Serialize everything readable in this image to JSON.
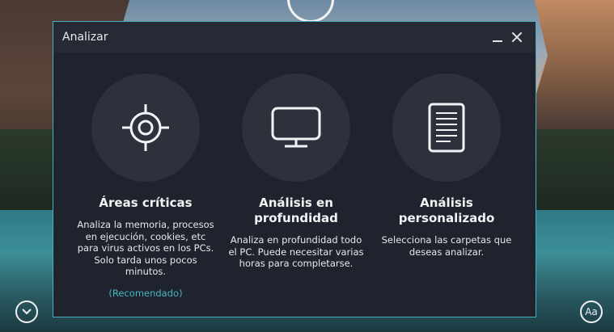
{
  "dialog": {
    "title": "Analizar",
    "minimize_icon": "minimize-icon",
    "close_icon": "close-icon"
  },
  "options": [
    {
      "icon": "crosshair-icon",
      "title": "Áreas críticas",
      "description": "Analiza la memoria, procesos en ejecución, cookies, etc para virus activos en los PCs. Solo tarda unos pocos minutos.",
      "recommended": "(Recomendado)"
    },
    {
      "icon": "monitor-icon",
      "title": "Análisis en profundidad",
      "description": "Analiza en profundidad todo el PC.  Puede necesitar varias horas  para completarse."
    },
    {
      "icon": "document-icon",
      "title": "Análisis personalizado",
      "description": "Selecciona las carpetas que deseas analizar."
    }
  ],
  "footer": {
    "expand_icon": "chevron-down-icon",
    "font_button_label": "Aa"
  },
  "colors": {
    "accent": "#45b6c3",
    "dialog_bg": "#262a35",
    "content_bg": "#1f232d",
    "circle_bg": "#2d313c"
  }
}
